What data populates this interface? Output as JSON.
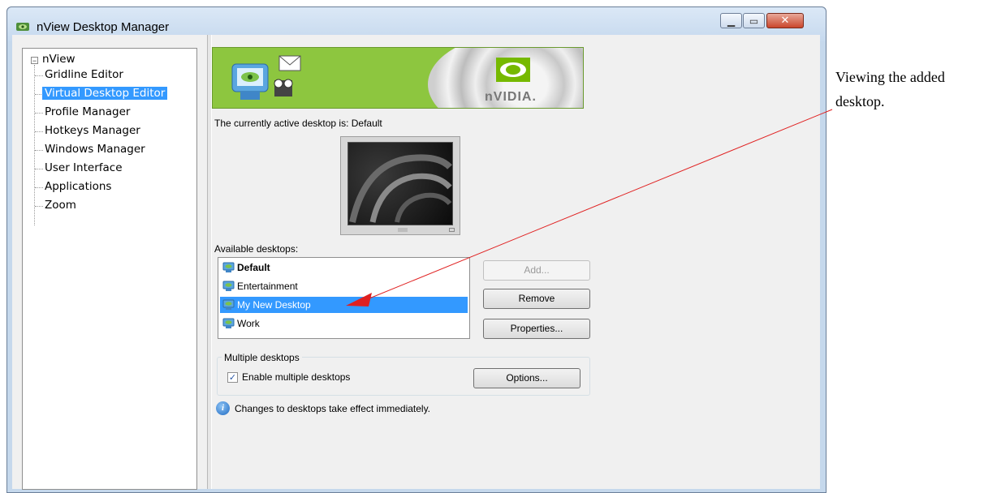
{
  "window": {
    "title": "nView Desktop Manager"
  },
  "tree": {
    "root": "nView",
    "items": [
      {
        "label": "Gridline Editor"
      },
      {
        "label": "Virtual Desktop Editor",
        "selected": true
      },
      {
        "label": "Profile Manager"
      },
      {
        "label": "Hotkeys Manager"
      },
      {
        "label": "Windows Manager"
      },
      {
        "label": "User Interface"
      },
      {
        "label": "Applications"
      },
      {
        "label": "Zoom"
      }
    ]
  },
  "banner": {
    "logo_text": "nVIDIA."
  },
  "main": {
    "active_desktop_text": "The currently active desktop is: Default",
    "available_label": "Available desktops:",
    "desktops": [
      {
        "name": "Default",
        "bold": true
      },
      {
        "name": "Entertainment"
      },
      {
        "name": "My New Desktop",
        "selected": true
      },
      {
        "name": "Work"
      }
    ],
    "buttons": {
      "add": "Add...",
      "remove": "Remove",
      "properties": "Properties...",
      "options": "Options..."
    },
    "group_title": "Multiple desktops",
    "enable_label": "Enable multiple desktops",
    "enable_checked": true,
    "info_text": "Changes to desktops take effect immediately."
  },
  "annotation": {
    "line1": "Viewing the added",
    "line2": "desktop."
  },
  "colors": {
    "selection": "#3399ff",
    "nvidia_green": "#8dc63f",
    "annotation_line": "#e02020"
  }
}
